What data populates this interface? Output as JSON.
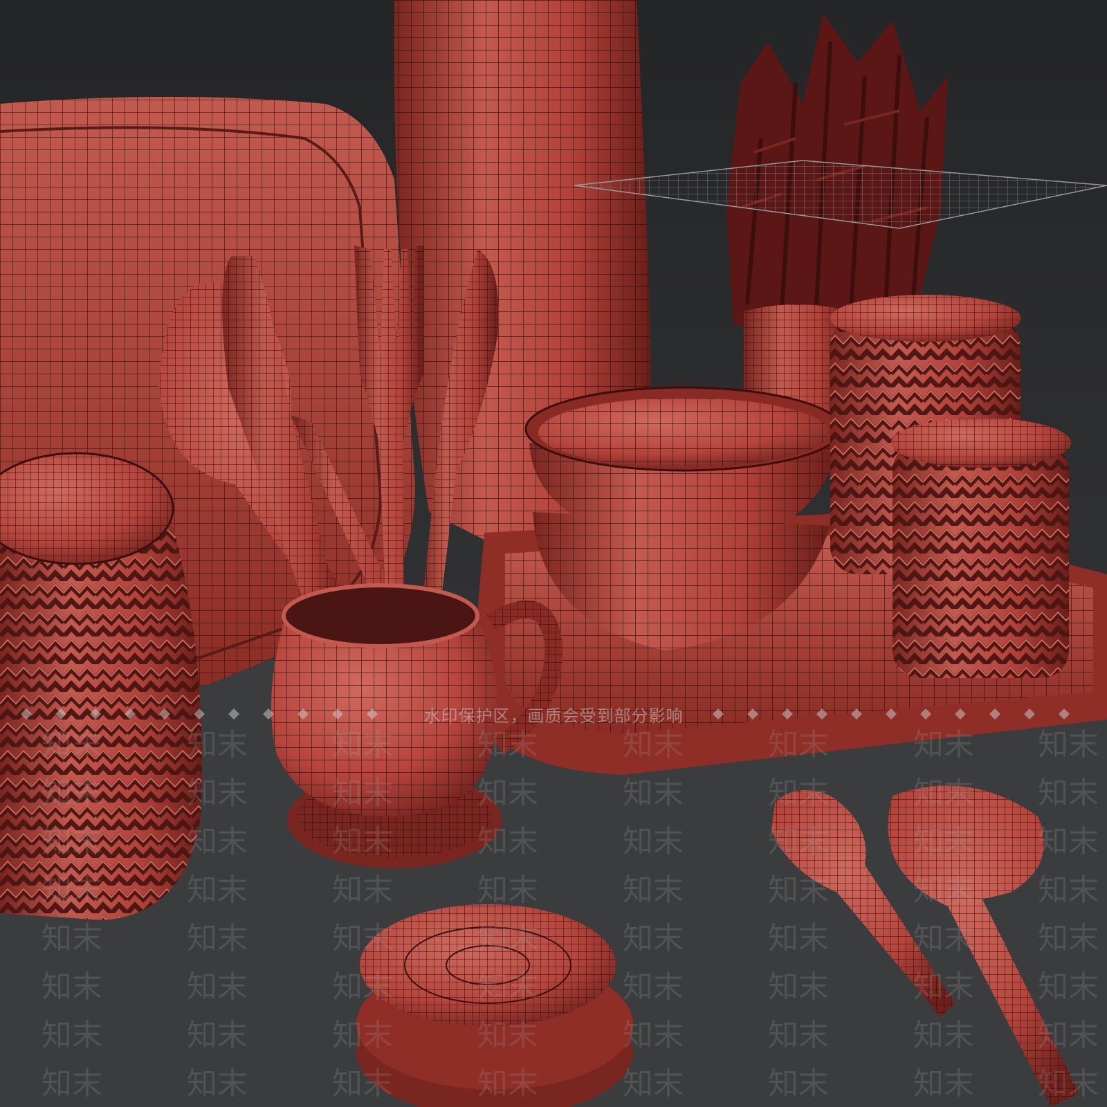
{
  "watermark": {
    "banner_text": "水印保护区，画质会受到部分影响",
    "tile_text": "知末"
  },
  "colors": {
    "background_top": "#2a2b2d",
    "background_bottom": "#3a3b3d",
    "mesh_base": "#b5453d",
    "mesh_shadow": "#6e201c",
    "mesh_highlight": "#cf6a5e",
    "wire": "#2a0c0a"
  }
}
